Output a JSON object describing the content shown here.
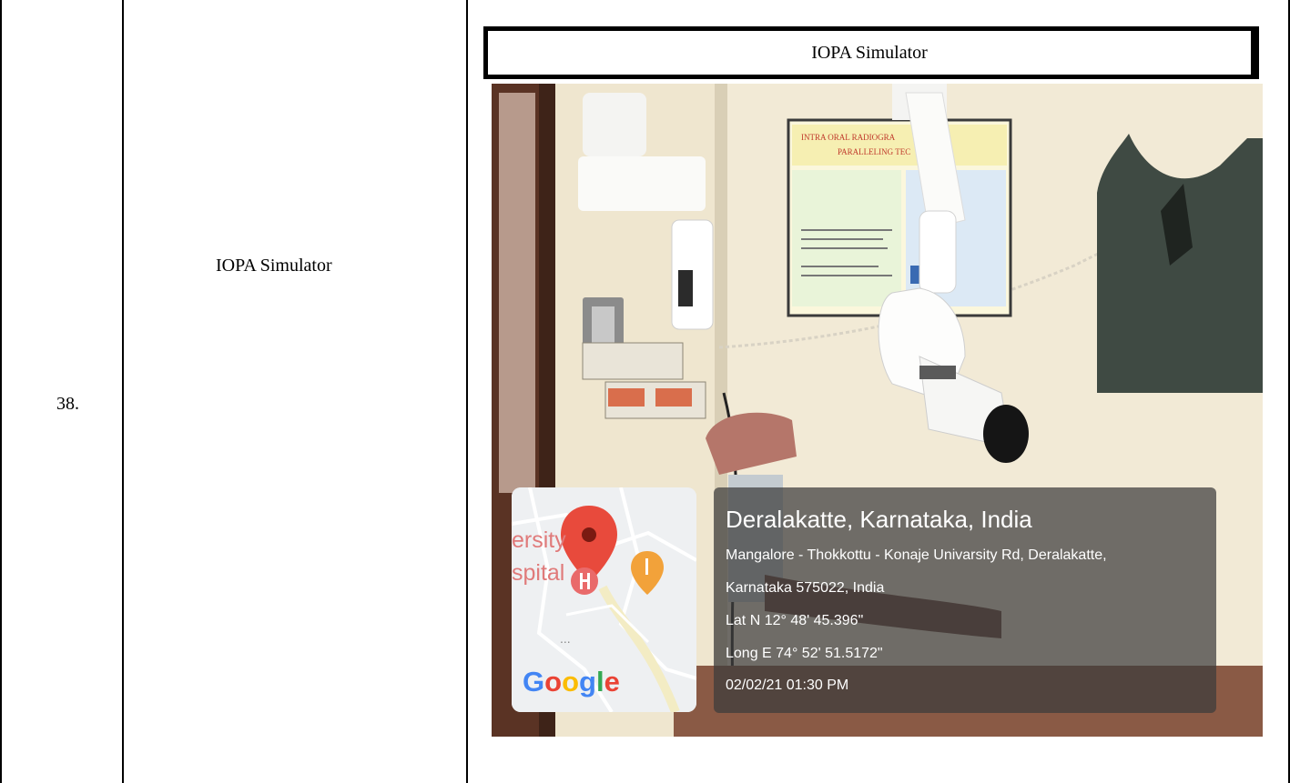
{
  "row": {
    "number": "38.",
    "name": "IOPA Simulator"
  },
  "figure": {
    "caption": "IOPA Simulator"
  },
  "photo": {
    "poster_title_line1": "INTRA ORAL RADIOGRA",
    "poster_title_line2": "PARALLELING TEC",
    "map": {
      "label_line1": "ersity",
      "label_line2": "spital",
      "ellipsis": "...",
      "logo": {
        "g1": "G",
        "o1": "o",
        "o2": "o",
        "g2": "g",
        "l": "l",
        "e": "e"
      }
    },
    "location": {
      "title": "Deralakatte, Karnataka, India",
      "address_line1": "Mangalore - Thokkottu - Konaje Univarsity Rd, Deralakatte,",
      "address_line2": "Karnataka 575022, India",
      "latitude": "Lat N 12° 48' 45.396\"",
      "longitude": "Long E 74° 52' 51.5172\"",
      "timestamp": "02/02/21 01:30 PM"
    }
  },
  "colors": {
    "wall": "#efe6cf",
    "overlay": "#3c3c3c",
    "pin_red": "#e84a3c",
    "pin_orange": "#f2a23a"
  }
}
